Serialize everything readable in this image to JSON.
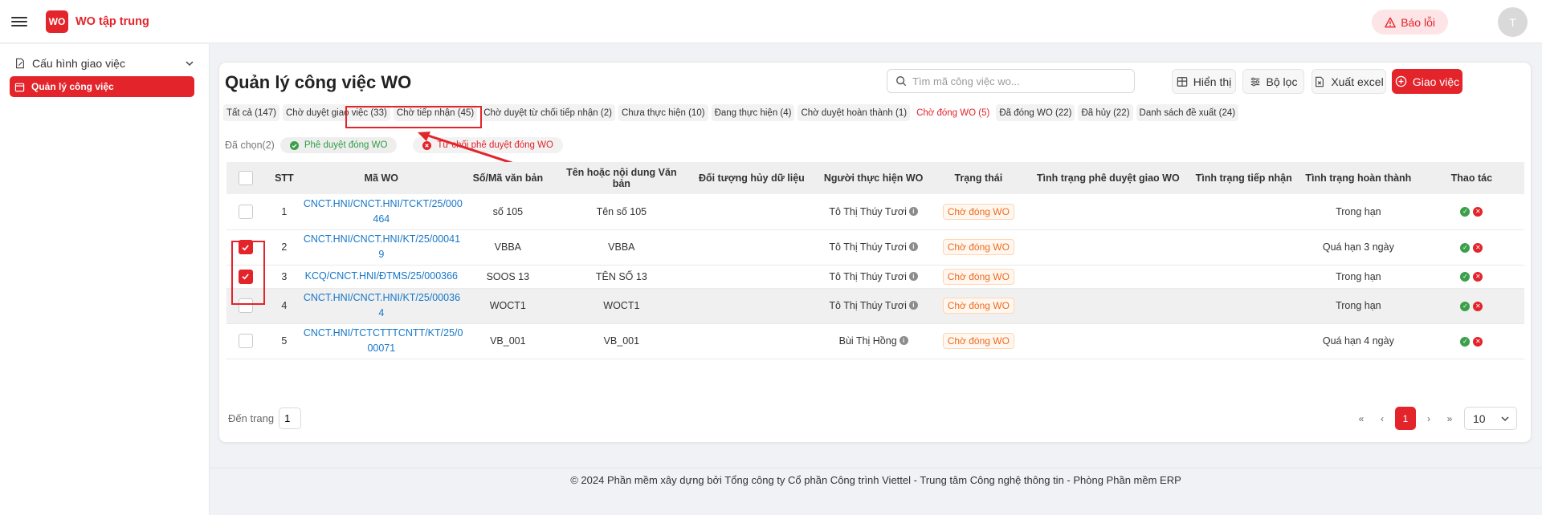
{
  "header": {
    "app_title": "WO tập trung",
    "logo_text": "WO",
    "bug_label": "Báo lỗi",
    "avatar_initial": "T"
  },
  "sidebar": {
    "group_label": "Cấu hình giao việc",
    "items": [
      {
        "label": "Quản lý công việc"
      }
    ]
  },
  "main": {
    "title": "Quản lý công việc WO",
    "search": {
      "placeholder": "Tìm mã công việc wo...",
      "value": ""
    },
    "buttons": {
      "display": "Hiển thị",
      "filter": "Bộ lọc",
      "export": "Xuất excel",
      "assign": "Giao việc"
    },
    "tabs": [
      {
        "label": "Tất cả (147)"
      },
      {
        "label": "Chờ duyệt giao việc (33)"
      },
      {
        "label": "Chờ tiếp nhận (45)"
      },
      {
        "label": "Chờ duyệt từ chối tiếp nhận (2)"
      },
      {
        "label": "Chưa thực hiện (10)"
      },
      {
        "label": "Đang thực hiện (4)"
      },
      {
        "label": "Chờ duyệt hoàn thành (1)"
      },
      {
        "label": "Chờ đóng WO (5)",
        "active": true
      },
      {
        "label": "Đã đóng WO (22)"
      },
      {
        "label": "Đã hủy (22)"
      },
      {
        "label": "Danh sách đề xuất (24)"
      }
    ],
    "selected_label": "Đã chọn(2)",
    "approve_close_label": "Phê duyệt đóng WO",
    "reject_close_label": "Từ chối phê duyệt đóng WO"
  },
  "table": {
    "columns": [
      "STT",
      "Mã WO",
      "Số/Mã văn bản",
      "Tên hoặc nội dung Văn bản",
      "Đối tượng hủy dữ liệu",
      "Người thực hiện WO",
      "Trạng thái",
      "Tình trạng phê duyệt giao WO",
      "Tình trạng tiếp nhận",
      "Tình trạng hoàn thành",
      "Thao tác"
    ],
    "rows": [
      {
        "stt": "1",
        "wo_l1": "CNCT.HNI/CNCT.HNI/TCKT/25/000",
        "wo_l2": "464",
        "doc_no": "số 105",
        "doc_name": "Tên số 105",
        "target": "",
        "assignee": "Tô Thị Thúy Tươi",
        "status": "Chờ đóng WO",
        "approval": "",
        "receipt": "",
        "completion": "Trong hạn",
        "checked": false
      },
      {
        "stt": "2",
        "wo_l1": "CNCT.HNI/CNCT.HNI/KT/25/00041",
        "wo_l2": "9",
        "doc_no": "VBBA",
        "doc_name": "VBBA",
        "target": "",
        "assignee": "Tô Thị Thúy Tươi",
        "status": "Chờ đóng WO",
        "approval": "",
        "receipt": "",
        "completion": "Quá hạn 3 ngày",
        "checked": true
      },
      {
        "stt": "3",
        "wo_l1": "KCQ/CNCT.HNI/ĐTMS/25/000366",
        "wo_l2": "",
        "doc_no": "SOOS 13",
        "doc_name": "TÊN SỐ 13",
        "target": "",
        "assignee": "Tô Thị Thúy Tươi",
        "status": "Chờ đóng WO",
        "approval": "",
        "receipt": "",
        "completion": "Trong hạn",
        "checked": true
      },
      {
        "stt": "4",
        "wo_l1": "CNCT.HNI/CNCT.HNI/KT/25/00036",
        "wo_l2": "4",
        "doc_no": "WOCT1",
        "doc_name": "WOCT1",
        "target": "",
        "assignee": "Tô Thị Thúy Tươi",
        "status": "Chờ đóng WO",
        "approval": "",
        "receipt": "",
        "completion": "Trong hạn",
        "checked": false
      },
      {
        "stt": "5",
        "wo_l1": "CNCT.HNI/TCTCTTTCNTT/KT/25/0",
        "wo_l2": "00071",
        "doc_no": "VB_001",
        "doc_name": "VB_001",
        "target": "",
        "assignee": "Bùi Thị Hồng",
        "status": "Chờ đóng WO",
        "approval": "",
        "receipt": "",
        "completion": "Quá hạn 4 ngày",
        "checked": false
      }
    ]
  },
  "pagination": {
    "goto_label": "Đến trang",
    "goto_value": "1",
    "current_page": "1",
    "page_size": "10"
  },
  "footer": {
    "text": "© 2024 Phần mềm xây dựng bởi Tổng công ty Cổ phần Công trình Viettel - Trung tâm Công nghệ thông tin - Phòng Phần mềm ERP"
  },
  "colors": {
    "accent": "#e3242b",
    "link": "#1677c8",
    "status": "#f06a1a",
    "success": "#3aa04a"
  }
}
